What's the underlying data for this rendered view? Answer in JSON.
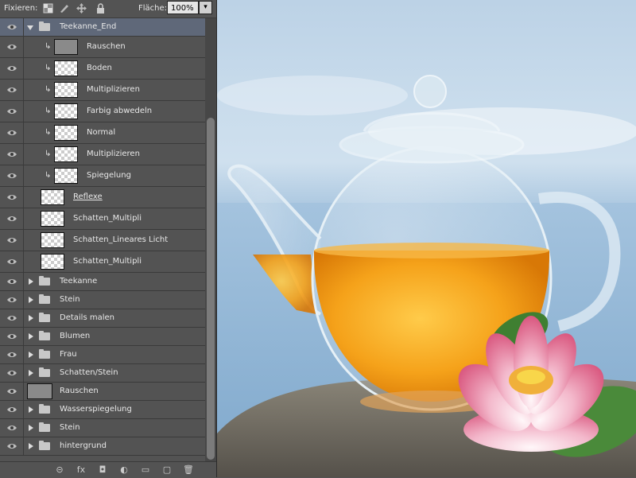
{
  "toolbar": {
    "lock_label": "Fixieren:",
    "fill_label": "Fläche:",
    "fill_value": "100%"
  },
  "layers": [
    {
      "name": "Teekanne_End",
      "type": "group-open",
      "selected": true
    },
    {
      "name": "Rauschen",
      "type": "layer",
      "clipped": true,
      "thumb": "gray",
      "indent": true
    },
    {
      "name": "Boden",
      "type": "layer",
      "clipped": true,
      "thumb": "checker",
      "indent": true
    },
    {
      "name": "Multiplizieren",
      "type": "layer",
      "clipped": true,
      "thumb": "checker",
      "indent": true
    },
    {
      "name": "Farbig abwedeln",
      "type": "layer",
      "clipped": true,
      "thumb": "checker",
      "indent": true
    },
    {
      "name": "Normal",
      "type": "layer",
      "clipped": true,
      "thumb": "checker",
      "indent": true
    },
    {
      "name": "Multiplizieren",
      "type": "layer",
      "clipped": true,
      "thumb": "checker",
      "indent": true
    },
    {
      "name": "Spiegelung",
      "type": "layer",
      "clipped": true,
      "thumb": "checker",
      "indent": true
    },
    {
      "name": "Reflexe",
      "type": "layer",
      "clipped": false,
      "thumb": "checker",
      "underline": true
    },
    {
      "name": "Schatten_Multipli",
      "type": "layer",
      "clipped": false,
      "thumb": "checker"
    },
    {
      "name": "Schatten_Lineares Licht",
      "type": "layer",
      "clipped": false,
      "thumb": "checker"
    },
    {
      "name": "Schatten_Multipli",
      "type": "layer",
      "clipped": false,
      "thumb": "checker"
    },
    {
      "name": "Teekanne",
      "type": "group"
    },
    {
      "name": "Stein",
      "type": "group"
    },
    {
      "name": "Details malen",
      "type": "group"
    },
    {
      "name": "Blumen",
      "type": "group"
    },
    {
      "name": "Frau",
      "type": "group"
    },
    {
      "name": "Schatten/Stein",
      "type": "group"
    },
    {
      "name": "Rauschen",
      "type": "layer-top",
      "thumb": "gray"
    },
    {
      "name": "Wasserspiegelung",
      "type": "group"
    },
    {
      "name": "Stein",
      "type": "group"
    },
    {
      "name": "hintergrund",
      "type": "group"
    }
  ],
  "footer_buttons": [
    "link-icon",
    "fx-icon",
    "mask-icon",
    "adjustment-icon",
    "new-group-icon",
    "new-layer-icon",
    "trash-icon"
  ],
  "footer_glyphs": [
    "⊝",
    "fx",
    "◘",
    "◐",
    "▭",
    "▢",
    "🗑"
  ]
}
